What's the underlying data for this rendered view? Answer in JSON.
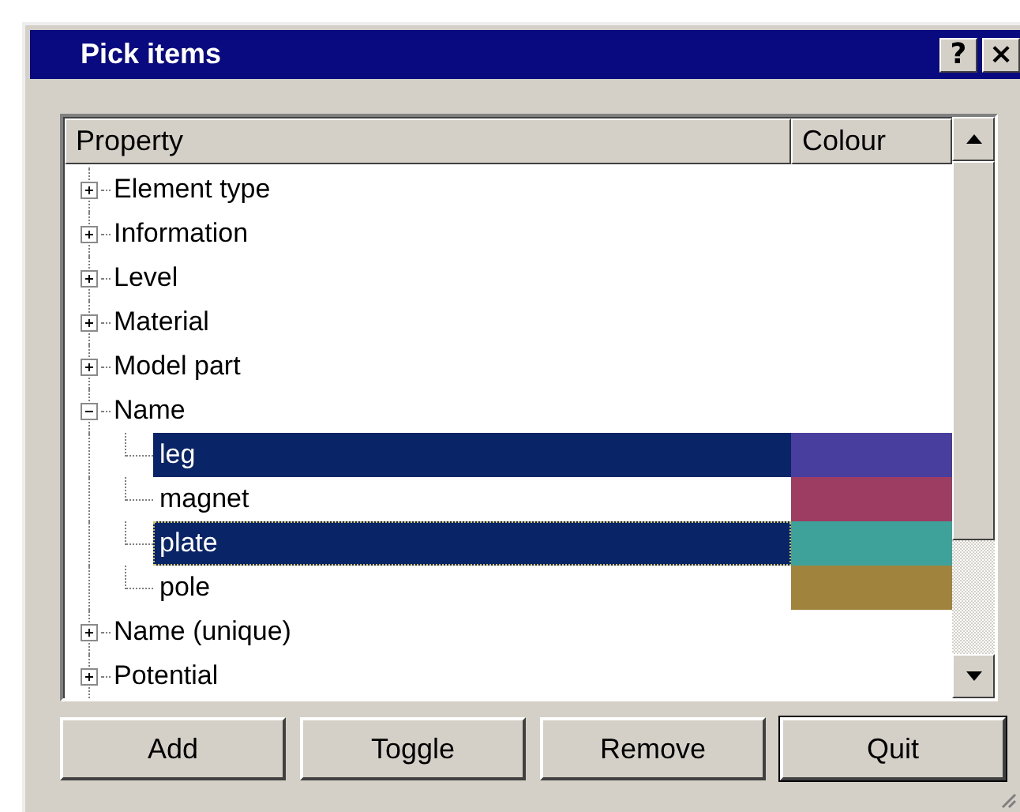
{
  "window": {
    "title": "Pick items",
    "title_buttons": [
      "?",
      "×"
    ]
  },
  "list": {
    "columns": [
      "Property",
      "Colour"
    ],
    "items": [
      {
        "label": "Element type",
        "expanded": false
      },
      {
        "label": "Information",
        "expanded": false
      },
      {
        "label": "Level",
        "expanded": false
      },
      {
        "label": "Material",
        "expanded": false
      },
      {
        "label": "Model part",
        "expanded": false
      },
      {
        "label": "Name",
        "expanded": true,
        "children": [
          {
            "label": "leg",
            "selected": true,
            "focused": false,
            "color": "#473e9e"
          },
          {
            "label": "magnet",
            "selected": false,
            "focused": false,
            "color": "#9e3d62"
          },
          {
            "label": "plate",
            "selected": true,
            "focused": true,
            "color": "#3fa29a"
          },
          {
            "label": "pole",
            "selected": false,
            "focused": false,
            "color": "#a0843e"
          }
        ]
      },
      {
        "label": "Name (unique)",
        "expanded": false
      },
      {
        "label": "Potential",
        "expanded": false
      }
    ]
  },
  "buttons": [
    {
      "label": "Add",
      "default": false
    },
    {
      "label": "Toggle",
      "default": false
    },
    {
      "label": "Remove",
      "default": false
    },
    {
      "label": "Quit",
      "default": true
    }
  ]
}
